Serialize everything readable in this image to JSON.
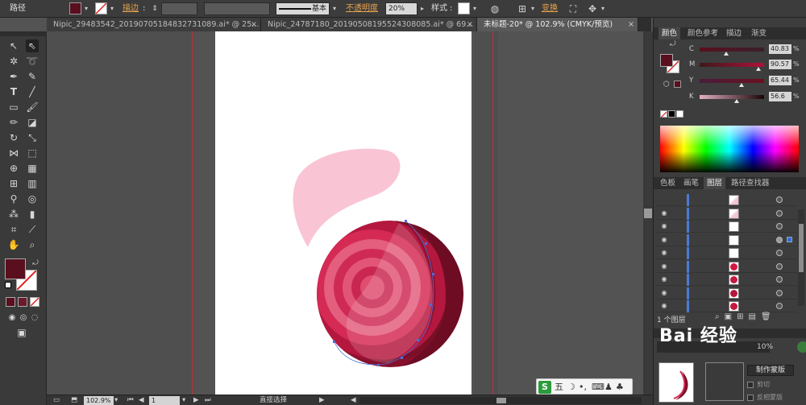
{
  "control_bar": {
    "path_label": "路径",
    "stroke_label": "描边",
    "opacity_label": "不透明度",
    "opacity_value": "20%",
    "style_label": "样式",
    "stroke_profile": "基本",
    "transform_label": "变换",
    "fill_color": "#5a0f1e"
  },
  "doc_tabs": [
    {
      "label": "Nipic_29483542_20190705184832731089.ai* @ 25...",
      "active": false
    },
    {
      "label": "Nipic_24787180_20190508195524308085.ai* @ 69...",
      "active": false
    },
    {
      "label": "未标题-20* @ 102.9% (CMYK/预览)",
      "active": true
    }
  ],
  "status_bar": {
    "zoom": "102.9%",
    "page": "1",
    "tool_name": "直接选择"
  },
  "color_panel": {
    "tabs": [
      "颜色",
      "颜色参考",
      "描边",
      "渐变"
    ],
    "channels": [
      {
        "name": "C",
        "value": "40.83",
        "knob": 0.41,
        "gradient": [
          "#5a0f1e",
          "#3a1f2a"
        ]
      },
      {
        "name": "M",
        "value": "90.57",
        "knob": 0.91,
        "gradient": [
          "#3b1a1c",
          "#b0103a"
        ]
      },
      {
        "name": "Y",
        "value": "65.44",
        "knob": 0.65,
        "gradient": [
          "#4a1d3a",
          "#6a1020"
        ]
      },
      {
        "name": "K",
        "value": "56.6",
        "knob": 0.57,
        "gradient": [
          "#e2b0c0",
          "#1a0508"
        ]
      }
    ],
    "pct": "%"
  },
  "layers_panel": {
    "tabs": [
      "色板",
      "画笔",
      "图层",
      "路径查找器"
    ],
    "active_tab": "图层",
    "count_label": "1 个图层",
    "rows": [
      {
        "visible": false,
        "thumb": "#f3c4d1"
      },
      {
        "visible": true,
        "thumb": "#f3c4d1"
      },
      {
        "visible": true,
        "thumb": "#ffffff"
      },
      {
        "visible": true,
        "thumb": "#ffffff",
        "selected": true
      },
      {
        "visible": true,
        "thumb": "#ffffff"
      },
      {
        "visible": true,
        "thumb": "#d21843"
      },
      {
        "visible": true,
        "thumb": "#c41a3f"
      },
      {
        "visible": true,
        "thumb": "#b3173a"
      },
      {
        "visible": true,
        "thumb": "#c41a3f"
      }
    ]
  },
  "transparency_panel": {
    "opacity_value": "10%",
    "make_mask": "制作蒙版",
    "clip_label": "剪切",
    "invert_mask": "反相蒙版"
  },
  "ime": {
    "logo": "S",
    "mode": "五"
  },
  "watermark": "Bai 经验"
}
